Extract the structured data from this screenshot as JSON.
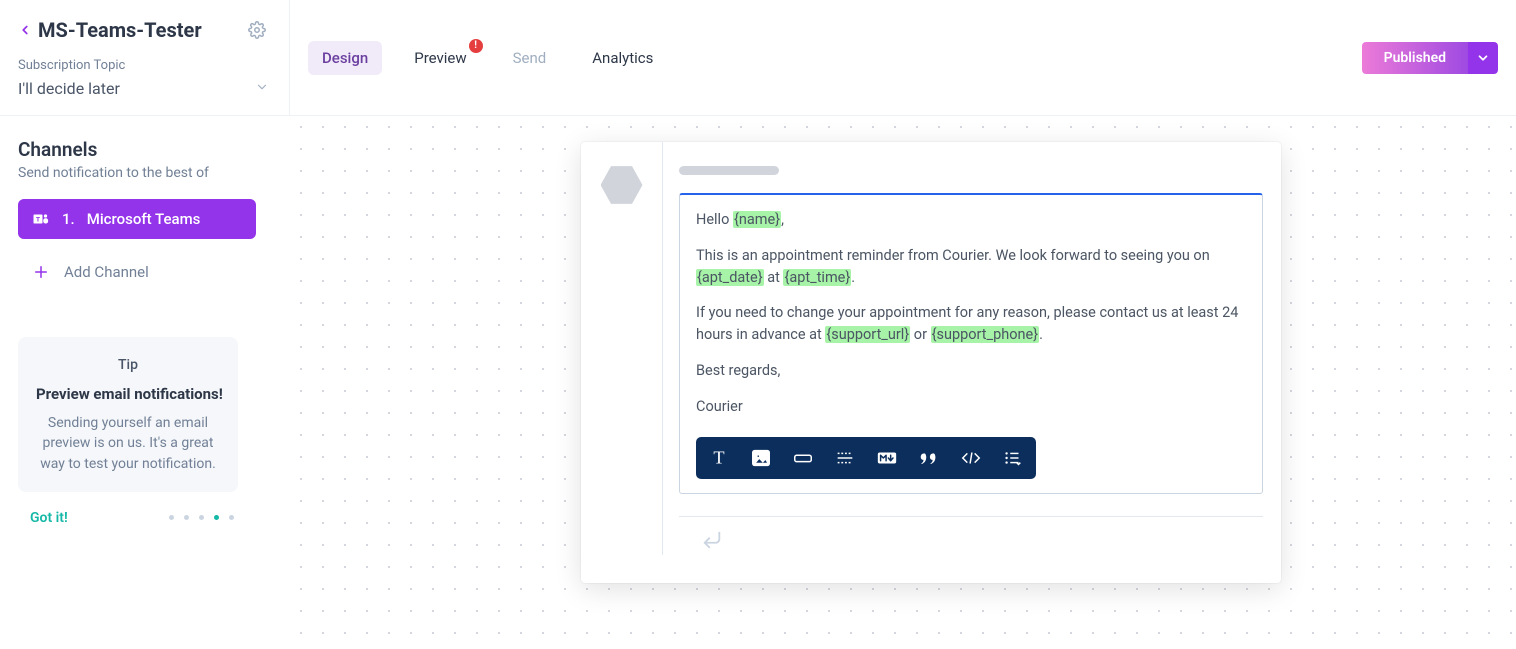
{
  "header": {
    "title": "MS-Teams-Tester",
    "subscription_label": "Subscription Topic",
    "subscription_value": "I'll decide later"
  },
  "tabs": {
    "design": "Design",
    "preview": "Preview",
    "send": "Send",
    "analytics": "Analytics",
    "preview_badge": "!"
  },
  "publish": {
    "label": "Published"
  },
  "sidebar": {
    "heading": "Channels",
    "sub": "Send notification to the best of",
    "channel_index": "1.",
    "channel_name": "Microsoft Teams",
    "add_channel": "Add Channel"
  },
  "tip": {
    "tag": "Tip",
    "title": "Preview email notifications!",
    "body": "Sending yourself an email preview is on us. It's a great way to test your notification.",
    "cta": "Got it!"
  },
  "editor": {
    "greeting_pre": "Hello ",
    "greeting_var": "{name}",
    "greeting_post": ",",
    "p2_pre": "This is an appointment reminder from Courier. We look forward to seeing you on ",
    "p2_var1": "{apt_date}",
    "p2_mid": " at ",
    "p2_var2": "{apt_time}",
    "p2_post": ".",
    "p3_pre": "If you need to change your appointment for any reason, please contact us at least 24 hours in advance at ",
    "p3_var1": "{support_url}",
    "p3_mid": " or ",
    "p3_var2": "{support_phone}",
    "p3_post": ".",
    "p4": "Best regards,",
    "p5": "Courier"
  }
}
